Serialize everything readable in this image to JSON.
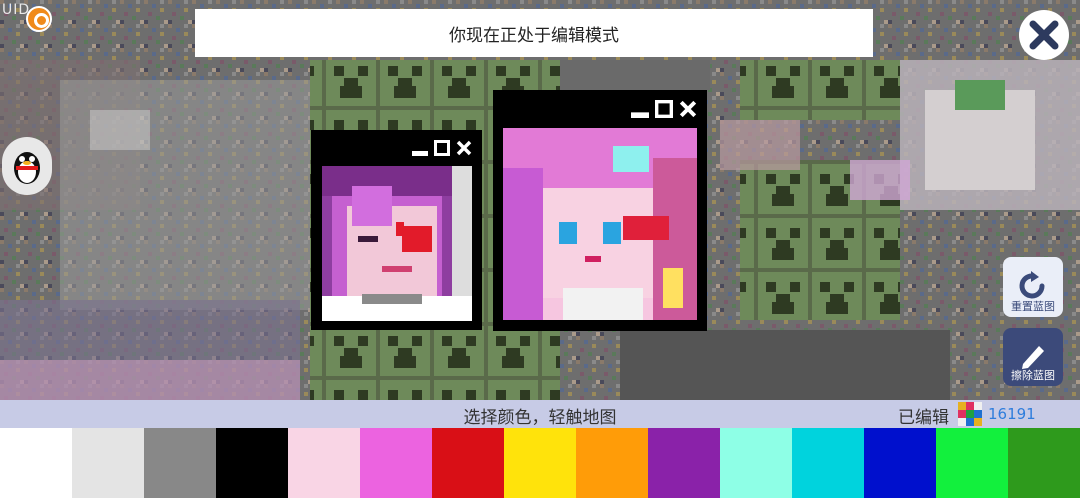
{
  "hud": {
    "uid_label": "UID"
  },
  "banner": {
    "text": "你现在正处于编辑模式"
  },
  "icons": {
    "close": "close-icon",
    "qq": "penguin-icon",
    "reset": "rotate-icon",
    "erase": "pencil-icon",
    "minimize": "minimize-icon",
    "maximize": "maximize-icon",
    "window_close": "x-icon"
  },
  "buttons": {
    "reset_label": "重置蓝图",
    "erase_label": "擦除蓝图"
  },
  "status": {
    "hint": "选择颜色，轻触地图",
    "edited_label": "已编辑",
    "edited_count": "16191"
  },
  "palette": [
    "#ffffff",
    "#e4e4e4",
    "#888888",
    "#000000",
    "#f9d5e5",
    "#ec63e0",
    "#d90f16",
    "#ffe30b",
    "#ff9c08",
    "#8a22a9",
    "#8effe6",
    "#00d3dd",
    "#0010cd",
    "#12f03d",
    "#2e9a1c"
  ]
}
